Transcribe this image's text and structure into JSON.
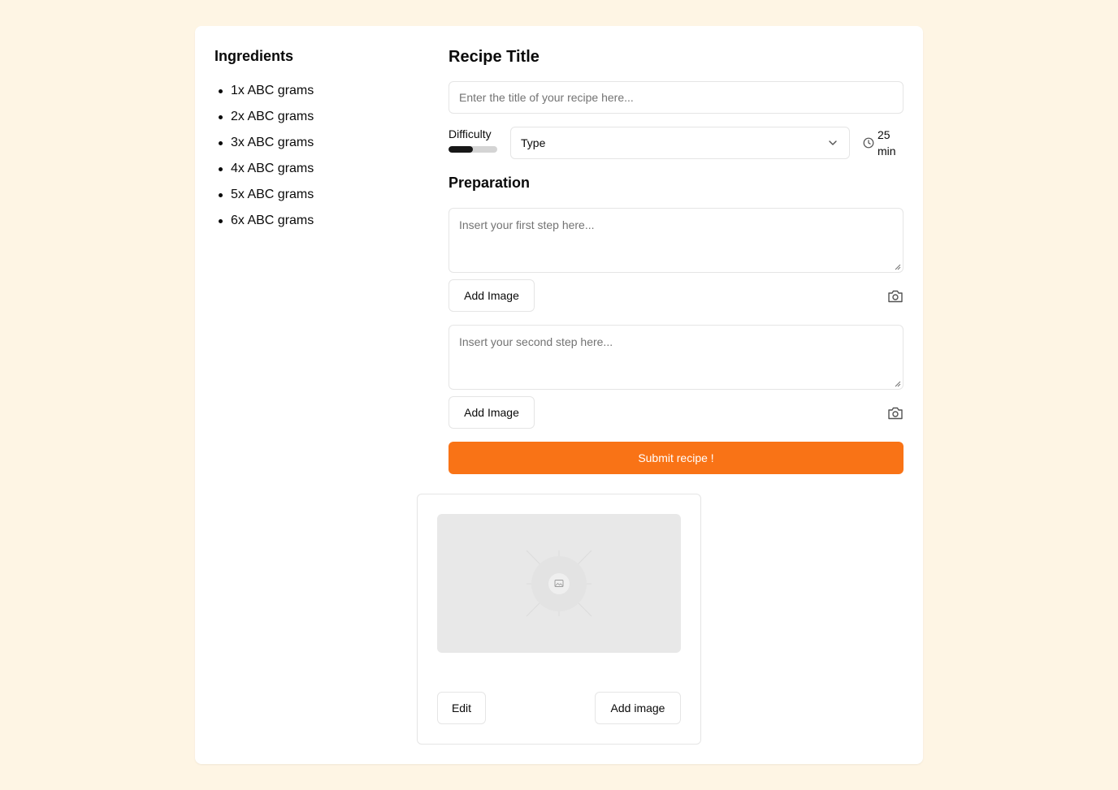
{
  "ingredients": {
    "title": "Ingredients",
    "items": [
      "1x ABC grams",
      "2x ABC grams",
      "3x ABC grams",
      "4x ABC grams",
      "5x ABC grams",
      "6x ABC grams"
    ]
  },
  "form": {
    "title": "Recipe Title",
    "title_placeholder": "Enter the title of your recipe here...",
    "difficulty_label": "Difficulty",
    "difficulty_level": 0.5,
    "type_value": "Type",
    "time_value": "25 min",
    "preparation_title": "Preparation",
    "steps": [
      {
        "placeholder": "Insert your first step here...",
        "add_image_label": "Add Image"
      },
      {
        "placeholder": "Insert your second step here...",
        "add_image_label": "Add Image"
      }
    ],
    "submit_label": "Submit recipe !"
  },
  "image_card": {
    "edit_label": "Edit",
    "add_image_label": "Add image"
  },
  "colors": {
    "background": "#fef5e4",
    "accent": "#f97316"
  }
}
